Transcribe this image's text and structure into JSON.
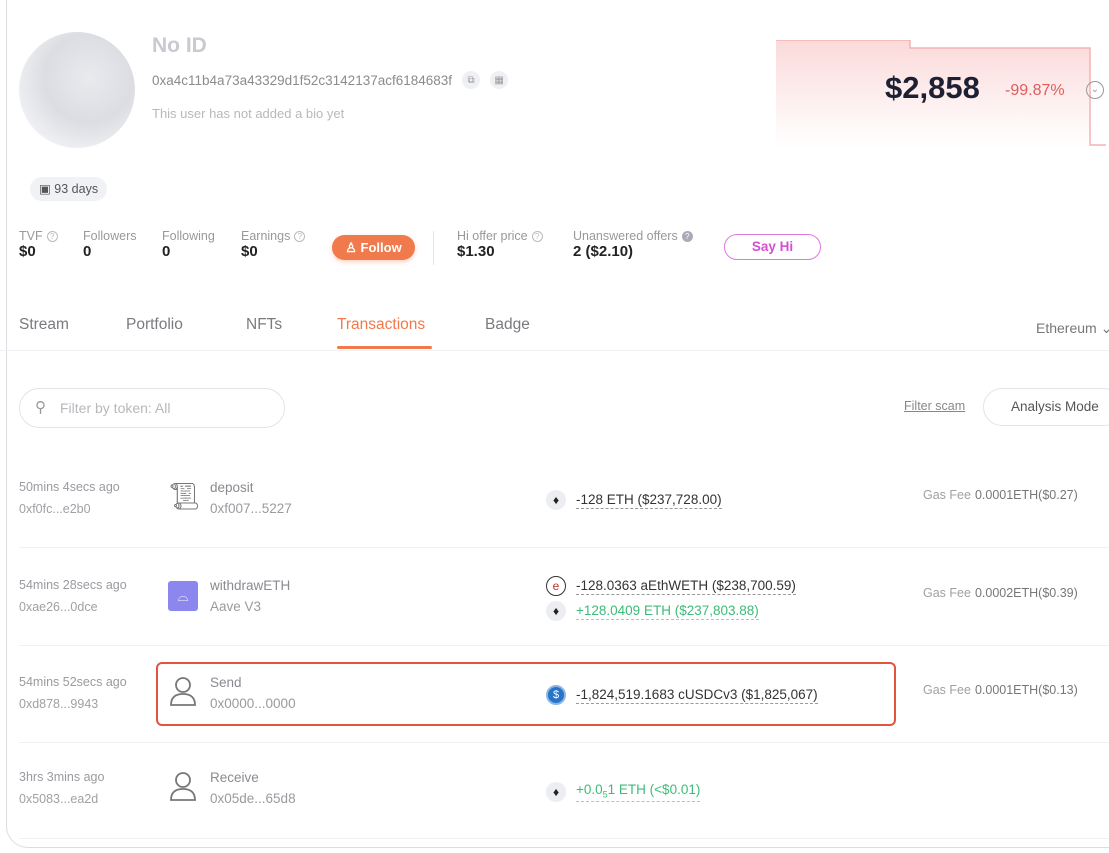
{
  "profile": {
    "name": "No ID",
    "address": "0xa4c11b4a73a43329d1f52c3142137acf6184683f",
    "bio": "This user has not added a bio yet",
    "age": "93 days"
  },
  "balance": {
    "total": "$2,858",
    "change": "-99.87%",
    "change_color": "#e05c5c"
  },
  "stats": [
    {
      "label": "TVF",
      "value": "$0",
      "help": true
    },
    {
      "label": "Followers",
      "value": "0"
    },
    {
      "label": "Following",
      "value": "0"
    },
    {
      "label": "Earnings",
      "value": "$0",
      "help": true
    }
  ],
  "follow_label": "Follow",
  "offers": [
    {
      "label": "Hi offer price",
      "value": "$1.30"
    },
    {
      "label": "Unanswered offers",
      "value": "2 ($2.10)"
    }
  ],
  "say_hi_label": "Say Hi",
  "tabs": [
    {
      "label": "Stream"
    },
    {
      "label": "Portfolio"
    },
    {
      "label": "NFTs"
    },
    {
      "label": "Transactions",
      "active": true
    },
    {
      "label": "Badge"
    }
  ],
  "chain": "Ethereum",
  "search": {
    "placeholder": "Filter by token: All"
  },
  "filter_scam": "Filter scam",
  "analysis_mode": "Analysis Mode",
  "accent": "#f07a4c",
  "transactions": [
    {
      "time": "50mins 4secs ago",
      "hash": "0xf0fc...e2b0",
      "icon": "scroll-icon",
      "action": "deposit",
      "target": "0xf007...5227",
      "amounts": [
        {
          "coin": "eth-icon",
          "text": "-128 ETH ($237,728.00)",
          "positive": false
        }
      ],
      "gas_label": "Gas Fee",
      "gas": "0.0001ETH($0.27)"
    },
    {
      "time": "54mins 28secs ago",
      "hash": "0xae26...0dce",
      "icon": "aave-icon",
      "action": "withdrawETH",
      "target": "Aave V3",
      "amounts": [
        {
          "coin": "aethweth-icon",
          "text": "-128.0363 aEthWETH ($238,700.59)",
          "positive": false
        },
        {
          "coin": "eth-icon",
          "text": "+128.0409 ETH ($237,803.88)",
          "positive": true
        }
      ],
      "gas_label": "Gas Fee",
      "gas": "0.0002ETH($0.39)"
    },
    {
      "time": "54mins 52secs ago",
      "hash": "0xd878...9943",
      "icon": "user-icon",
      "action": "Send",
      "target": "0x0000...0000",
      "amounts": [
        {
          "coin": "usdc-icon",
          "text": "-1,824,519.1683 cUSDCv3 ($1,825,067)",
          "positive": false
        }
      ],
      "gas_label": "Gas Fee",
      "gas": "0.0001ETH($0.13)",
      "highlighted": true
    },
    {
      "time": "3hrs 3mins ago",
      "hash": "0x5083...ea2d",
      "icon": "user-icon",
      "action": "Receive",
      "target": "0x05de...65d8",
      "amounts": [
        {
          "coin": "eth-icon",
          "text_prefix": "+0.0",
          "text_sub": "5",
          "text_suffix": "1 ETH (<$0.01)",
          "positive": true
        }
      ]
    }
  ]
}
